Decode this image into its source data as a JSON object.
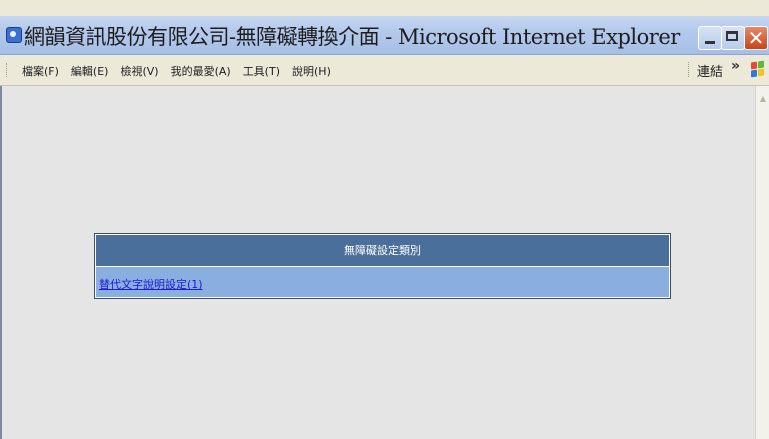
{
  "window": {
    "title": "網韻資訊股份有限公司-無障礙轉換介面 - Microsoft Internet Explorer"
  },
  "menu": {
    "items": [
      "檔案(F)",
      "編輯(E)",
      "檢視(V)",
      "我的最愛(A)",
      "工具(T)",
      "說明(H)"
    ],
    "links_label": "連結",
    "chevron": "»"
  },
  "panel": {
    "header": "無障礙設定類別",
    "link": "替代文字說明設定(1)"
  },
  "colors": {
    "header_bg": "#4b6f9b",
    "row_bg": "#8aaee0",
    "link": "#1b1bd6"
  }
}
